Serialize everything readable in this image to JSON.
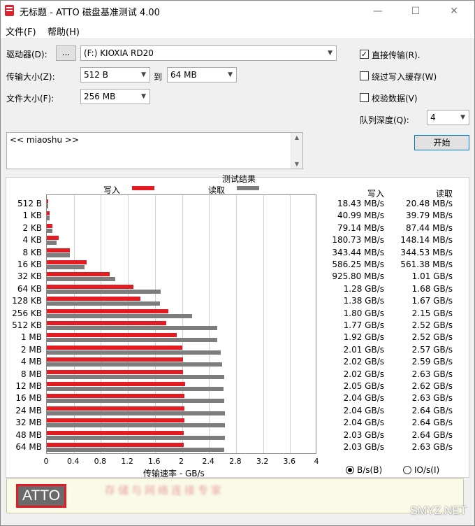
{
  "window": {
    "title": "无标题 - ATTO 磁盘基准测试 4.00",
    "controls": {
      "minimize": "—",
      "maximize": "☐",
      "close": "✕"
    }
  },
  "menu": {
    "file": "文件(F)",
    "help": "帮助(H)"
  },
  "settings": {
    "drive_label": "驱动器(D):",
    "browse_label": "...",
    "drive_value": "(F:) KIOXIA RD20",
    "transfer_label": "传输大小(Z):",
    "transfer_from": "512 B",
    "to_label": "到",
    "transfer_to": "64 MB",
    "file_size_label": "文件大小(F):",
    "file_size": "256 MB",
    "direct_io_label": "直接传输(R).",
    "direct_io_checked": true,
    "bypass_cache_label": "绕过写入缓存(W)",
    "bypass_cache_checked": false,
    "verify_label": "校验数据(V)",
    "verify_checked": false,
    "queue_depth_label": "队列深度(Q):",
    "queue_depth": "4",
    "start_label": "开始"
  },
  "notes": {
    "text": "<< miaoshu >>"
  },
  "results": {
    "title": "测试结果",
    "legend_write": "写入",
    "legend_read": "读取",
    "col_write": "写入",
    "col_read": "读取",
    "xlabel": "传输速率 - GB/s",
    "unit_bytes": "B/s(B)",
    "unit_io": "IO/s(I)",
    "unit_selected": "bytes"
  },
  "colors": {
    "write": "#e31b23",
    "read": "#7d7d7d"
  },
  "chart_data": {
    "type": "bar",
    "orientation": "horizontal",
    "title": "测试结果",
    "xlabel": "传输速率 - GB/s",
    "xlim": [
      0,
      4
    ],
    "xticks": [
      "0",
      "0.4",
      "0.8",
      "1.2",
      "1.6",
      "2",
      "2.4",
      "2.8",
      "3.2",
      "3.6",
      "4"
    ],
    "grid": true,
    "legend": "top",
    "categories": [
      "512 B",
      "1 KB",
      "2 KB",
      "4 KB",
      "8 KB",
      "16 KB",
      "32 KB",
      "64 KB",
      "128 KB",
      "256 KB",
      "512 KB",
      "1 MB",
      "2 MB",
      "4 MB",
      "8 MB",
      "12 MB",
      "16 MB",
      "24 MB",
      "32 MB",
      "48 MB",
      "64 MB"
    ],
    "series": [
      {
        "name": "写入",
        "values": [
          0.01843,
          0.04099,
          0.07914,
          0.18073,
          0.34344,
          0.58625,
          0.9258,
          1.28,
          1.38,
          1.8,
          1.77,
          1.92,
          2.01,
          2.02,
          2.02,
          2.05,
          2.04,
          2.04,
          2.04,
          2.03,
          2.03
        ],
        "labels": [
          "18.43 MB/s",
          "40.99 MB/s",
          "79.14 MB/s",
          "180.73 MB/s",
          "343.44 MB/s",
          "586.25 MB/s",
          "925.80 MB/s",
          "1.28 GB/s",
          "1.38 GB/s",
          "1.80 GB/s",
          "1.77 GB/s",
          "1.92 GB/s",
          "2.01 GB/s",
          "2.02 GB/s",
          "2.02 GB/s",
          "2.05 GB/s",
          "2.04 GB/s",
          "2.04 GB/s",
          "2.04 GB/s",
          "2.03 GB/s",
          "2.03 GB/s"
        ]
      },
      {
        "name": "读取",
        "values": [
          0.02048,
          0.03979,
          0.08744,
          0.14814,
          0.34453,
          0.56138,
          1.01,
          1.68,
          1.67,
          2.15,
          2.52,
          2.52,
          2.57,
          2.59,
          2.63,
          2.62,
          2.63,
          2.64,
          2.64,
          2.64,
          2.63
        ],
        "labels": [
          "20.48 MB/s",
          "39.79 MB/s",
          "87.44 MB/s",
          "148.14 MB/s",
          "344.53 MB/s",
          "561.38 MB/s",
          "1.01 GB/s",
          "1.68 GB/s",
          "1.67 GB/s",
          "2.15 GB/s",
          "2.52 GB/s",
          "2.52 GB/s",
          "2.57 GB/s",
          "2.59 GB/s",
          "2.63 GB/s",
          "2.62 GB/s",
          "2.63 GB/s",
          "2.64 GB/s",
          "2.64 GB/s",
          "2.64 GB/s",
          "2.63 GB/s"
        ]
      }
    ]
  },
  "banner": {
    "logo": "ATTO",
    "text": "存储与网络连接专家"
  },
  "watermark": "SMYZ.NET"
}
